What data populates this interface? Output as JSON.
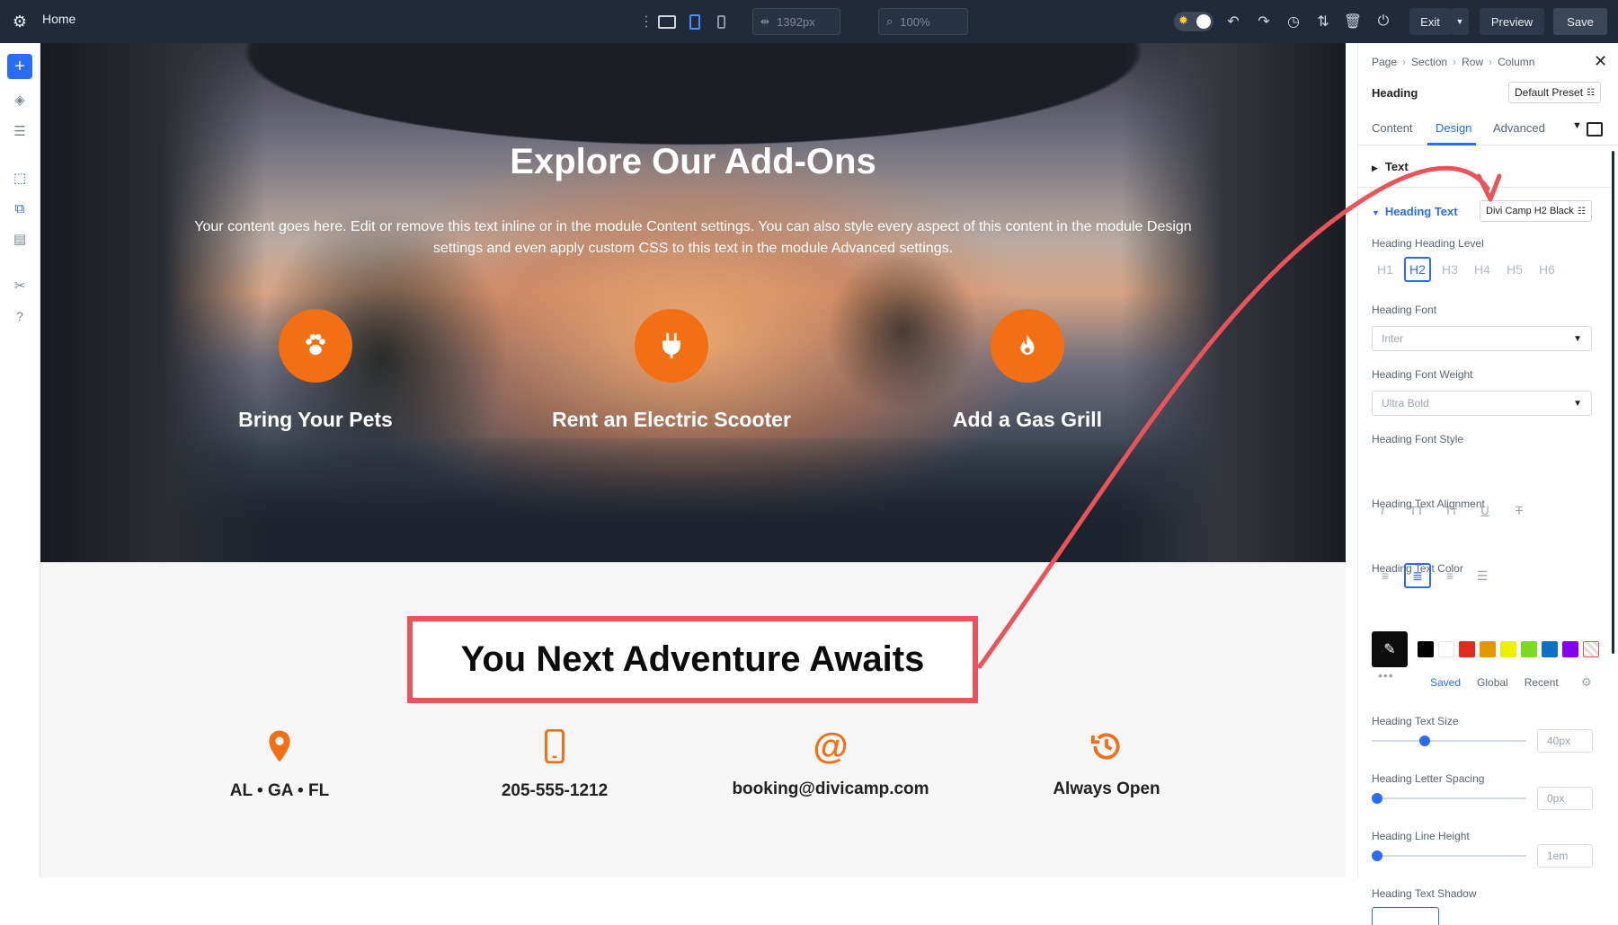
{
  "topbar": {
    "title": "Home",
    "width_field": "1392px",
    "zoom_field": "100%",
    "exit_label": "Exit",
    "preview_label": "Preview",
    "save_label": "Save"
  },
  "hero": {
    "title": "Explore Our Add-Ons",
    "body": "Your content goes here. Edit or remove this text inline or in the module Content settings. You can also style every aspect of this content in the module Design settings and even apply custom CSS to this text in the module Advanced settings.",
    "features": [
      {
        "label": "Bring Your Pets",
        "icon": "paw-icon"
      },
      {
        "label": "Rent an Electric Scooter",
        "icon": "plug-icon"
      },
      {
        "label": "Add a Gas Grill",
        "icon": "flame-icon"
      }
    ]
  },
  "section2": {
    "title": "You Next Adventure Awaits",
    "contacts": [
      {
        "text": "AL • GA • FL",
        "icon": "map-pin-icon"
      },
      {
        "text": "205-555-1212",
        "icon": "phone-icon"
      },
      {
        "text": "booking@divicamp.com",
        "icon": "at-icon"
      },
      {
        "text": "Always Open",
        "icon": "history-icon"
      }
    ]
  },
  "panel": {
    "breadcrumb": [
      "Page",
      "Section",
      "Row",
      "Column"
    ],
    "module": "Heading",
    "preset": "Default Preset",
    "tabs": [
      "Content",
      "Design",
      "Advanced"
    ],
    "active_tab": "Design",
    "group_text": "Text",
    "group_heading_text": "Heading Text",
    "heading_preset": "Divi Camp H2 Black",
    "heading_level_label": "Heading Heading Level",
    "heading_levels": [
      "H1",
      "H2",
      "H3",
      "H4",
      "H5",
      "H6"
    ],
    "selected_level": "H2",
    "font_label": "Heading Font",
    "font_value": "Inter",
    "weight_label": "Heading Font Weight",
    "weight_value": "Ultra Bold",
    "style_label": "Heading Font Style",
    "style_buttons": [
      "I",
      "TT",
      "Tт",
      "U",
      "T"
    ],
    "align_label": "Heading Text Alignment",
    "color_label": "Heading Text Color",
    "swatches": [
      "#000000",
      "#ffffff",
      "#e02b20",
      "#e09900",
      "#edf000",
      "#7cda24",
      "#0c71c3",
      "#8300e9"
    ],
    "color_tabs": [
      "Saved",
      "Global",
      "Recent"
    ],
    "active_color_tab": "Saved",
    "size_label": "Heading Text Size",
    "size_value": "40px",
    "size_fraction": 0.33,
    "letter_label": "Heading Letter Spacing",
    "letter_value": "0px",
    "letter_fraction": 0.0,
    "line_label": "Heading Line Height",
    "line_value": "1em",
    "line_fraction": 0.0,
    "shadow_label": "Heading Text Shadow"
  },
  "colors": {
    "accent": "#2b6cf6",
    "orange": "#f36f13",
    "highlight": "#e9545b",
    "topbar": "#1f2a3a"
  }
}
